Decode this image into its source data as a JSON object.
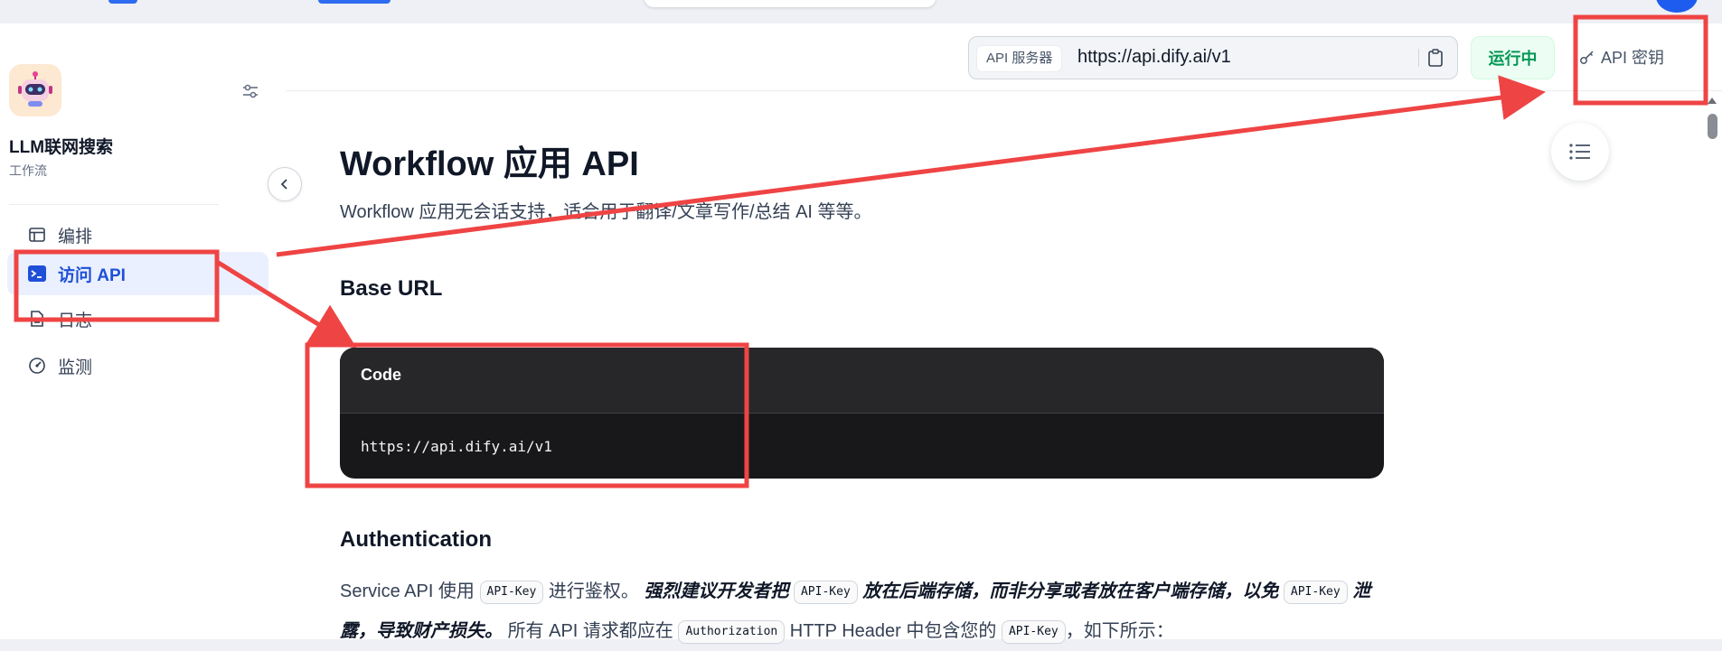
{
  "app": {
    "name": "LLM联网搜索",
    "type": "工作流"
  },
  "sidebar": {
    "items": [
      {
        "label": "编排",
        "icon": "layout-icon",
        "active": false
      },
      {
        "label": "访问 API",
        "icon": "terminal-icon",
        "active": true
      },
      {
        "label": "日志",
        "icon": "file-icon",
        "active": false
      },
      {
        "label": "监测",
        "icon": "gauge-icon",
        "active": false
      }
    ]
  },
  "header": {
    "api_server_tag": "API 服务器",
    "api_server_url": "https://api.dify.ai/v1",
    "status": "运行中",
    "api_key_label": "API 密钥"
  },
  "doc": {
    "title": "Workflow 应用 API",
    "subtitle": "Workflow 应用无会话支持，适合用于翻译/文章写作/总结 AI 等等。",
    "base_url_heading": "Base URL",
    "code_title": "Code",
    "code_text": "https://api.dify.ai/v1",
    "auth_heading": "Authentication",
    "auth_parts": {
      "p1": "Service API 使用",
      "code1": "API-Key",
      "p2": "进行鉴权。",
      "s1": "强烈建议开发者把",
      "code2": "API-Key",
      "s2": "放在后端存储，而非分享或者放在客户端存储，以免",
      "code3": "API-Key",
      "s3": "泄露，导致财产损失。",
      "p3": "所有 API 请求都应在",
      "code4": "Authorization",
      "p4": "HTTP Header 中包含您的",
      "code5": "API-Key",
      "p5": "，如下所示："
    }
  },
  "colors": {
    "accent": "#1f4fd8",
    "active_bg": "#eaf0ff",
    "status_green": "#039855",
    "annotation_red": "#ef4444",
    "code_bg": "#18181b"
  }
}
